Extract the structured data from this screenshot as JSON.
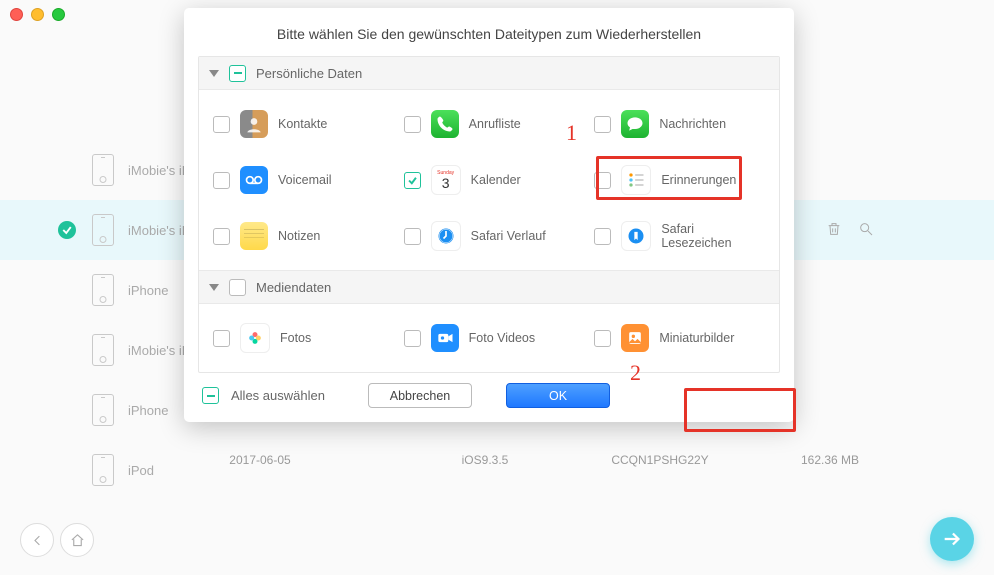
{
  "window": {
    "traffic_lights": [
      "red",
      "yellow",
      "green"
    ]
  },
  "devices": [
    {
      "name": "iMobie's iPh",
      "selected": false
    },
    {
      "name": "iMobie's iPh",
      "selected": true
    },
    {
      "name": "iPhone",
      "selected": false
    },
    {
      "name": "iMobie's iPh",
      "selected": false
    },
    {
      "name": "iPhone",
      "selected": false
    },
    {
      "name": "iPod",
      "selected": false
    }
  ],
  "info": {
    "date": "2017-06-05",
    "ios": "iOS9.3.5",
    "serial": "CCQN1PSHG22Y",
    "size": "162.36 MB"
  },
  "modal": {
    "title": "Bitte wählen Sie den gewünschten Dateitypen zum Wiederherstellen",
    "sections": [
      {
        "title": "Persönliche Daten",
        "state": "indeterminate",
        "items": [
          {
            "key": "kontakte",
            "label": "Kontakte",
            "checked": false
          },
          {
            "key": "anrufliste",
            "label": "Anrufliste",
            "checked": false
          },
          {
            "key": "nachrichten",
            "label": "Nachrichten",
            "checked": false
          },
          {
            "key": "voicemail",
            "label": "Voicemail",
            "checked": false
          },
          {
            "key": "kalender",
            "label": "Kalender",
            "checked": true
          },
          {
            "key": "erinnerungen",
            "label": "Erinnerungen",
            "checked": false
          },
          {
            "key": "notizen",
            "label": "Notizen",
            "checked": false
          },
          {
            "key": "safari_verlauf",
            "label": "Safari Verlauf",
            "checked": false
          },
          {
            "key": "safari_lesezeichen",
            "label": "Safari Lesezeichen",
            "checked": false
          }
        ]
      },
      {
        "title": "Mediendaten",
        "state": "unchecked",
        "items": [
          {
            "key": "fotos",
            "label": "Fotos",
            "checked": false
          },
          {
            "key": "foto_videos",
            "label": "Foto Videos",
            "checked": false
          },
          {
            "key": "miniaturbilder",
            "label": "Miniaturbilder",
            "checked": false
          }
        ]
      }
    ],
    "select_all": {
      "label": "Alles auswählen",
      "state": "indeterminate"
    },
    "buttons": {
      "cancel": "Abbrechen",
      "ok": "OK"
    }
  },
  "annotations": {
    "step1": "1",
    "step2": "2"
  }
}
